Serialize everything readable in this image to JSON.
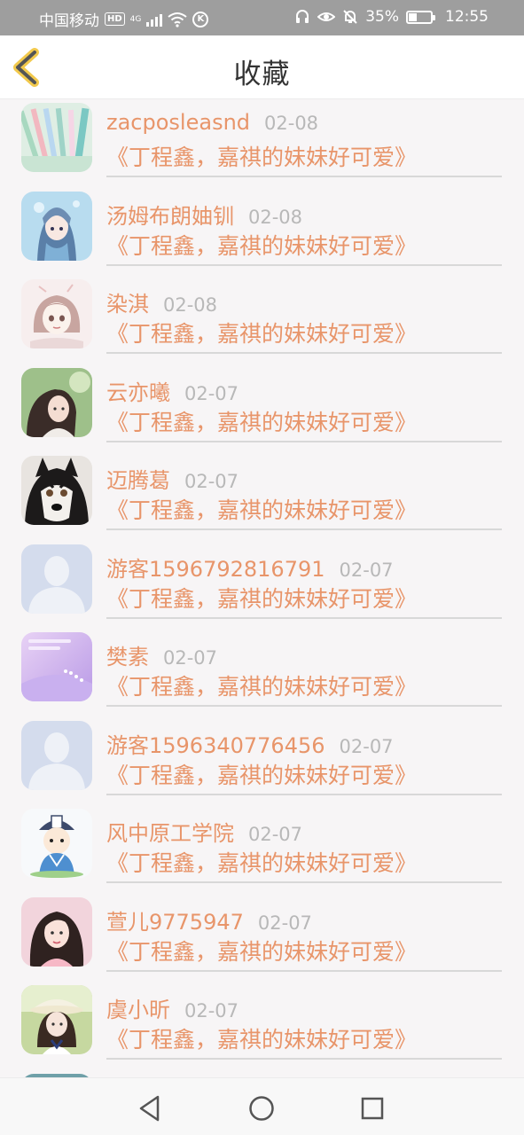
{
  "status_bar": {
    "carrier": "中国移动",
    "hd_badge": "HD",
    "network": "4G",
    "battery": "35%",
    "battery_level": 0.35,
    "time": "12:55"
  },
  "header": {
    "title": "收藏",
    "back_icon": "chevron-left-icon",
    "accent_color": "#f2c94c"
  },
  "colors": {
    "username": "#e8956a",
    "title": "#e8956a",
    "date": "#b8b8b8"
  },
  "items": [
    {
      "username": "zacposleasnd",
      "date": "02-08",
      "title": "《丁程鑫，嘉祺的妹妹好可爱》",
      "avatar": "pens"
    },
    {
      "username": "汤姆布朗妯钏",
      "date": "02-08",
      "title": "《丁程鑫，嘉祺的妹妹好可爱》",
      "avatar": "anime-girl"
    },
    {
      "username": "染淇",
      "date": "02-08",
      "title": "《丁程鑫，嘉祺的妹妹好可爱》",
      "avatar": "sketch-girl"
    },
    {
      "username": "云亦曦",
      "date": "02-07",
      "title": "《丁程鑫，嘉祺的妹妹好可爱》",
      "avatar": "girl-photo"
    },
    {
      "username": "迈腾葛",
      "date": "02-07",
      "title": "《丁程鑫，嘉祺的妹妹好可爱》",
      "avatar": "husky"
    },
    {
      "username": "游客1596792816791",
      "date": "02-07",
      "title": "《丁程鑫，嘉祺的妹妹好可爱》",
      "avatar": "default"
    },
    {
      "username": "樊素",
      "date": "02-07",
      "title": "《丁程鑫，嘉祺的妹妹好可爱》",
      "avatar": "purple"
    },
    {
      "username": "游客1596340776456",
      "date": "02-07",
      "title": "《丁程鑫，嘉祺的妹妹好可爱》",
      "avatar": "default"
    },
    {
      "username": "风中原工学院",
      "date": "02-07",
      "title": "《丁程鑫，嘉祺的妹妹好可爱》",
      "avatar": "cartoon"
    },
    {
      "username": "萱儿9775947",
      "date": "02-07",
      "title": "《丁程鑫，嘉祺的妹妹好可爱》",
      "avatar": "girl-pink"
    },
    {
      "username": "虞小昕",
      "date": "02-07",
      "title": "《丁程鑫，嘉祺的妹妹好可爱》",
      "avatar": "girl-hat"
    }
  ],
  "nav_bar": {
    "back_icon": "triangle-back-icon",
    "home_icon": "circle-home-icon",
    "recents_icon": "square-recents-icon"
  }
}
